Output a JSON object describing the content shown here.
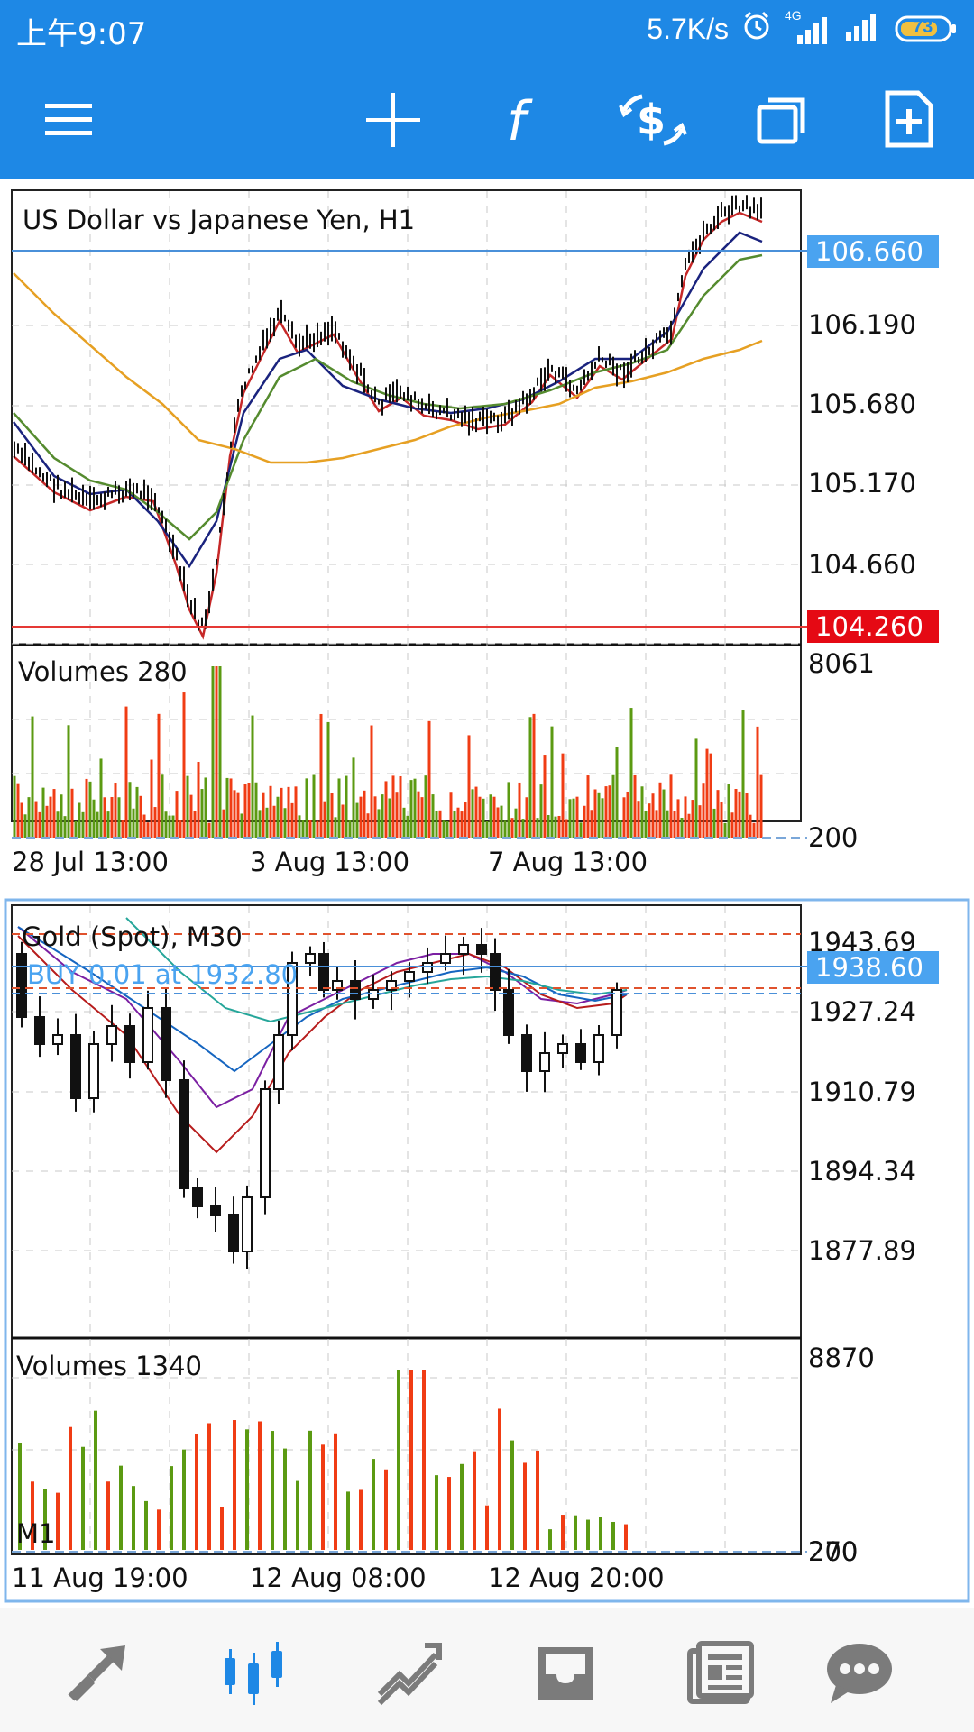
{
  "status_bar": {
    "time": "上午9:07",
    "net_speed": "5.7K/s",
    "network_type": "4G",
    "battery": "73"
  },
  "toolbar": {
    "icons": [
      "menu-icon",
      "crosshair-icon",
      "indicators-icon",
      "symbols-icon",
      "windows-icon",
      "new-order-icon"
    ]
  },
  "chart1": {
    "title": "US Dollar vs Japanese Yen, H1",
    "price_axis": [
      "106.190",
      "105.680",
      "105.170",
      "104.660"
    ],
    "ask_tag": "106.660",
    "bid_tag": "104.260",
    "volume_label": "Volumes 280",
    "volume_axis_top": "8061",
    "volume_axis_bottom": "200",
    "time_axis": [
      "28 Jul 13:00",
      "3 Aug 13:00",
      "7 Aug 13:00"
    ],
    "colors": {
      "ma_fast": "#c62828",
      "ma_mid": "#1a237e",
      "ma_slow": "#558b2f",
      "ma_long": "#e6a023",
      "ask_line": "#4a90d9",
      "bid_line": "#e53935",
      "vol_up": "#5b9a12",
      "vol_down": "#f03c14"
    }
  },
  "chart2": {
    "title": "Gold (Spot), M30",
    "order_label": "BUY 0.01 at 1932.80",
    "price_axis": [
      "1943.69",
      "1927.24",
      "1910.79",
      "1894.34",
      "1877.89"
    ],
    "bid_tag": "1938.60",
    "volume_label": "Volumes 1340",
    "volume_axis_top": "8870",
    "volume_axis_bottom": "200",
    "volume_axis_bottom_overlap": "270",
    "lot_label": "M1",
    "time_axis": [
      "11 Aug 19:00",
      "12 Aug 08:00",
      "12 Aug 20:00"
    ],
    "colors": {
      "accent": "#4aa3f0",
      "order_line": "#4a90d9",
      "level_line": "#e0522d"
    }
  },
  "bottom_nav": {
    "items": [
      "trade-icon",
      "chart-icon",
      "history-icon",
      "inbox-icon",
      "news-icon",
      "chat-icon"
    ],
    "active": "chart-icon"
  }
}
